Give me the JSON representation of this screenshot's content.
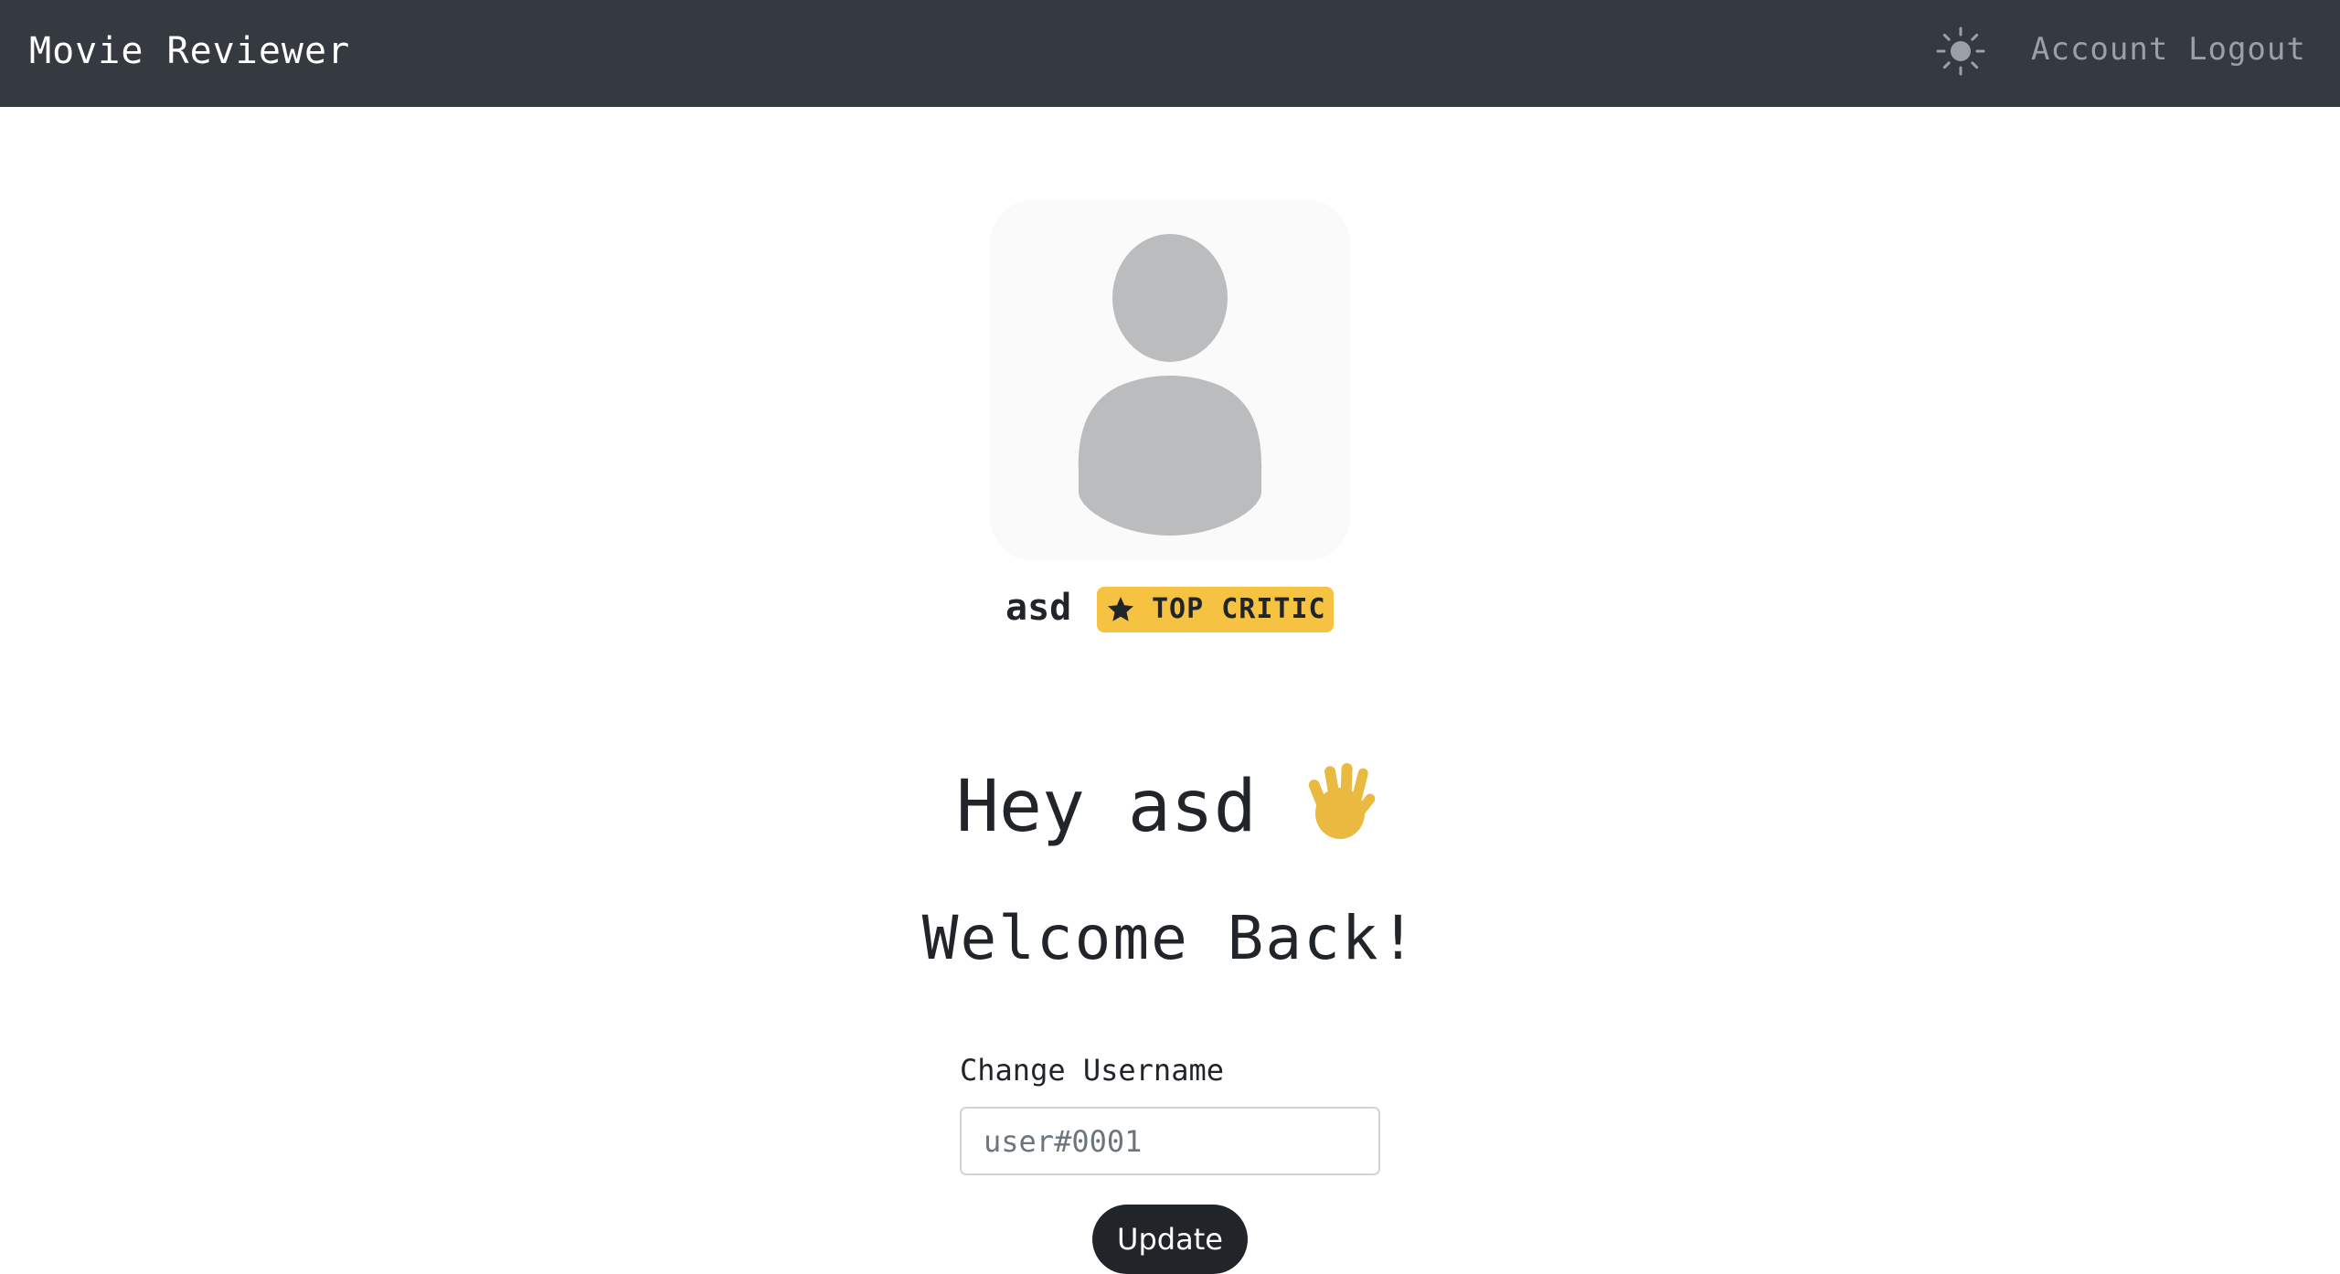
{
  "navbar": {
    "brand": "Movie Reviewer",
    "theme_toggle_icon": "sun-icon",
    "links": {
      "account": "Account",
      "logout": "Logout"
    },
    "background": "#343a40"
  },
  "profile": {
    "avatar_icon": "user-avatar-icon",
    "username": "asd",
    "badge": {
      "icon": "star-icon",
      "label": "TOP CRITIC",
      "color": "#f5c242"
    }
  },
  "greeting": {
    "text": "Hey asd",
    "icon": "waving-hand-icon",
    "subtitle": "Welcome Back!"
  },
  "form": {
    "label": "Change Username",
    "input_value": "",
    "input_placeholder": "user#0001",
    "submit_label": "Update"
  }
}
